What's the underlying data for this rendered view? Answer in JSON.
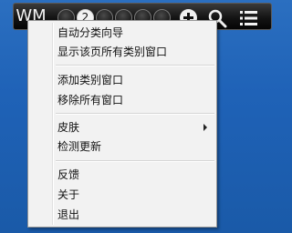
{
  "toolbar": {
    "logo_text": "WM",
    "slot_active_number": "2",
    "icons": [
      "circle-slot-icon",
      "circle-slot-icon",
      "circle-slot-icon",
      "circle-slot-icon",
      "circle-slot-icon",
      "plus-icon",
      "search-icon",
      "list-icon"
    ]
  },
  "menu": {
    "items": [
      {
        "label": "自动分类向导"
      },
      {
        "label": "显示该页所有类别窗口"
      },
      {
        "label": "添加类别窗口"
      },
      {
        "label": "移除所有窗口"
      },
      {
        "label": "皮肤",
        "submenu": true
      },
      {
        "label": "检测更新"
      },
      {
        "label": "反馈"
      },
      {
        "label": "关于"
      },
      {
        "label": "退出"
      }
    ]
  }
}
